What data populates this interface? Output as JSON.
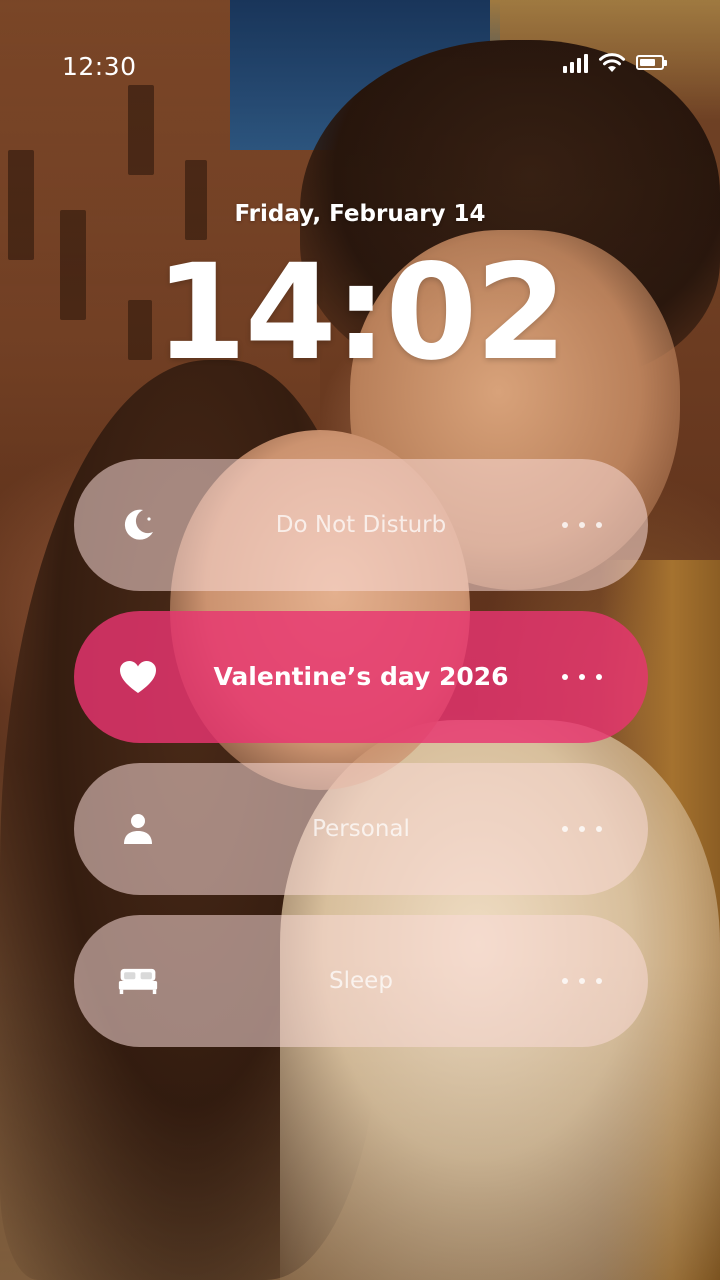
{
  "status_bar": {
    "time": "12:30",
    "signal_icon": "cellular-signal-icon",
    "wifi_icon": "wifi-icon",
    "battery_icon": "battery-icon",
    "battery_level": 0.75
  },
  "lock_screen": {
    "date": "Friday, February 14",
    "time": "14:02"
  },
  "focus_modes": [
    {
      "label": "Do Not Disturb",
      "icon": "moon-icon",
      "active": false
    },
    {
      "label": "Valentine’s day 2026",
      "icon": "heart-icon",
      "active": true
    },
    {
      "label": "Personal",
      "icon": "person-icon",
      "active": false
    },
    {
      "label": "Sleep",
      "icon": "bed-icon",
      "active": false
    }
  ],
  "colors": {
    "active_focus": "#E83470",
    "inactive_focus": "#FADAD7"
  }
}
